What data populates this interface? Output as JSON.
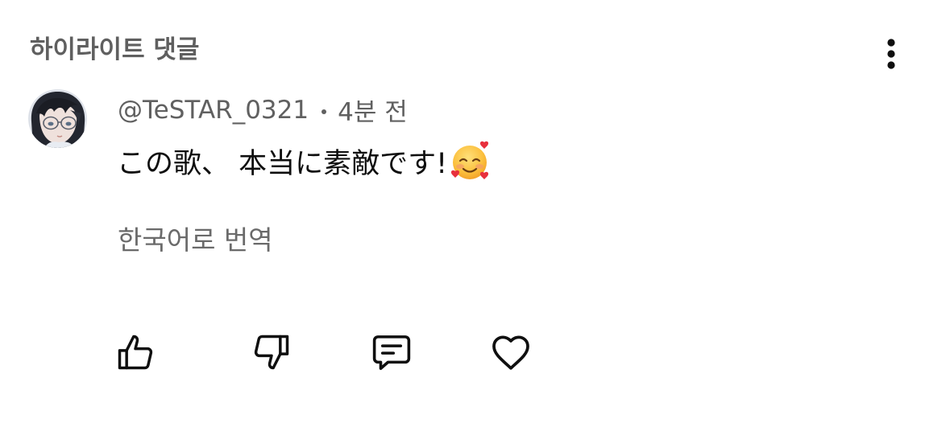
{
  "section": {
    "title": "하이라이트 댓글"
  },
  "comment": {
    "author": "@TeSTAR_0321",
    "time": "4분 전",
    "text": "この歌、 本当に素敵です!",
    "emoji": "smiling-face-with-hearts",
    "translate_label": "한국어로 번역"
  },
  "actions": [
    {
      "icon": "thumbs-up-icon"
    },
    {
      "icon": "thumbs-down-icon"
    },
    {
      "icon": "reply-icon"
    },
    {
      "icon": "heart-icon"
    }
  ],
  "colors": {
    "title": "#5f5f5f",
    "meta": "#606060",
    "text": "#0f0f0f",
    "icon": "#0f0f0f"
  }
}
